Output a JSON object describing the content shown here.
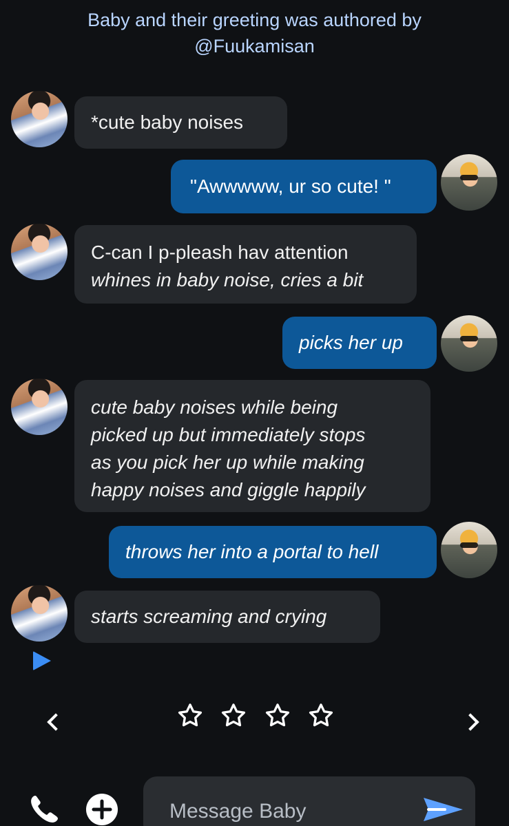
{
  "header": {
    "line1": "Baby and their greeting was authored by",
    "line2": "@Fuukamisan"
  },
  "messages": [
    {
      "sender": "bot",
      "text": "*cute baby noises",
      "style": "normal"
    },
    {
      "sender": "user",
      "text": "\"Awwwww, ur so cute! \"",
      "style": "normal"
    },
    {
      "sender": "bot",
      "line1": "C-can I p-pleash hav attention",
      "line2": "whines in baby noise, cries a bit",
      "style": "mixed"
    },
    {
      "sender": "user",
      "text": "picks her up",
      "style": "italic"
    },
    {
      "sender": "bot",
      "lines": [
        "cute baby noises while being",
        "picked up but immediately stops",
        "as you pick her up while making",
        "happy noises and giggle happily"
      ],
      "style": "italic"
    },
    {
      "sender": "user",
      "text": "throws her into a portal to hell",
      "style": "italic"
    },
    {
      "sender": "bot",
      "text": "starts screaming and crying",
      "style": "italic"
    }
  ],
  "rating": {
    "stars": 4,
    "filled": 0
  },
  "composer": {
    "placeholder": "Message Baby"
  },
  "icons": {
    "play": "play-icon",
    "previous": "chevron-left-icon",
    "next": "chevron-right-icon",
    "call": "phone-icon",
    "add": "plus-icon",
    "send": "send-icon",
    "star": "star-outline-icon"
  },
  "colors": {
    "background": "#0f1114",
    "incoming_bubble": "#25282c",
    "outgoing_bubble": "#0d5898",
    "header_text": "#b9d5ff",
    "accent_play": "#3b8df4",
    "send": "#5ea1ff"
  }
}
